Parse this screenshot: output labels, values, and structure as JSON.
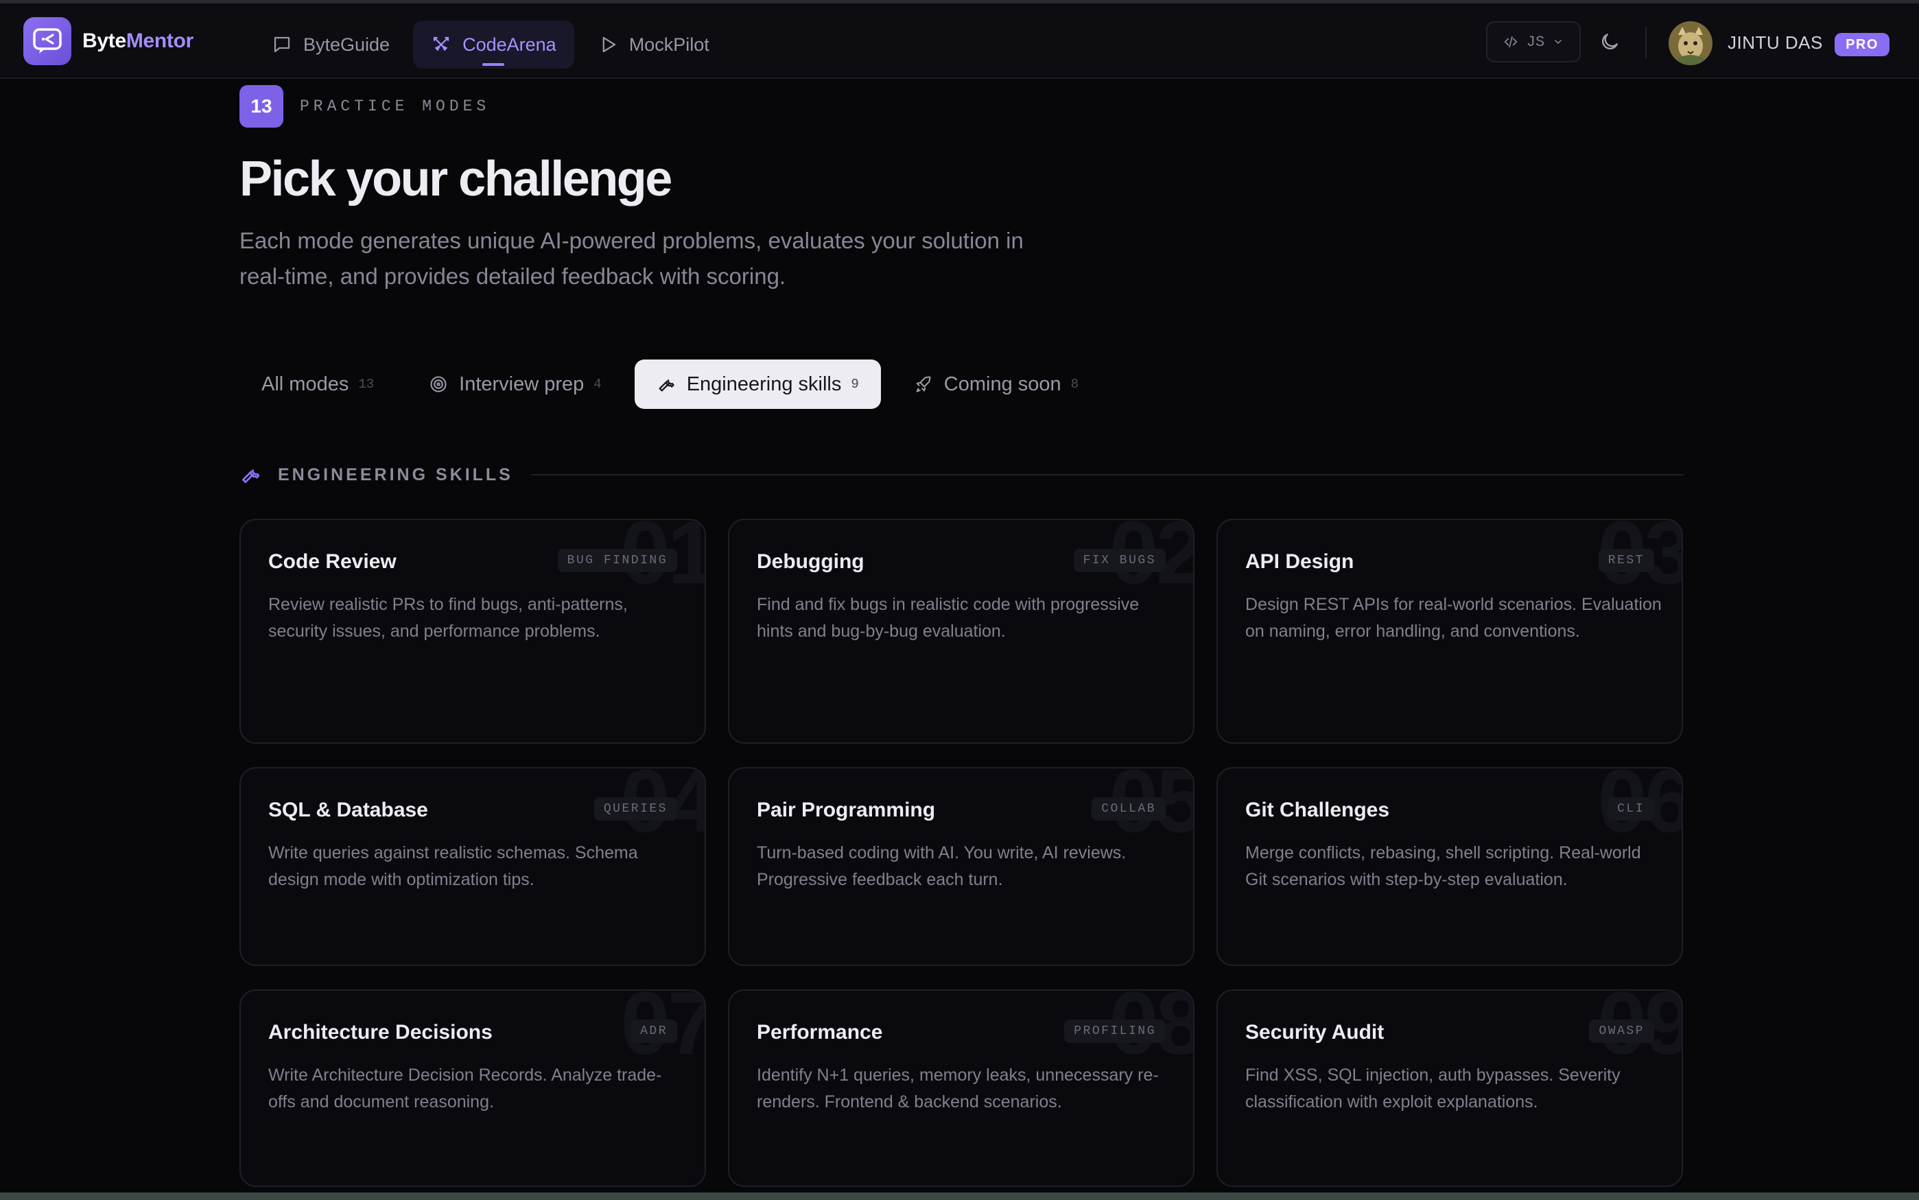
{
  "nav": {
    "brand_prefix": "Byte",
    "brand_accent": "Mentor",
    "tabs": [
      {
        "label": "ByteGuide",
        "icon": "chat-bubble-icon",
        "active": false
      },
      {
        "label": "CodeArena",
        "icon": "crossed-swords-icon",
        "active": true
      },
      {
        "label": "MockPilot",
        "icon": "play-icon",
        "active": false
      }
    ],
    "language": "JS",
    "user_name": "JINTU DAS",
    "plan_badge": "PRO"
  },
  "hero": {
    "count": "13",
    "eyebrow": "PRACTICE MODES",
    "title": "Pick your challenge",
    "subtitle": "Each mode generates unique AI-powered problems, evaluates your solution in real-time, and provides detailed feedback with scoring."
  },
  "filters": [
    {
      "label": "All modes",
      "count": "13",
      "icon": "",
      "active": false
    },
    {
      "label": "Interview prep",
      "count": "4",
      "icon": "target-icon",
      "active": false
    },
    {
      "label": "Engineering skills",
      "count": "9",
      "icon": "wrench-icon",
      "active": true
    },
    {
      "label": "Coming soon",
      "count": "8",
      "icon": "rocket-icon",
      "active": false
    }
  ],
  "section": {
    "label": "ENGINEERING SKILLS",
    "icon": "wrench-icon"
  },
  "cards": [
    {
      "num": "01",
      "title": "Code Review",
      "tag": "BUG FINDING",
      "desc": "Review realistic PRs to find bugs, anti-patterns, security issues, and performance problems."
    },
    {
      "num": "02",
      "title": "Debugging",
      "tag": "FIX BUGS",
      "desc": "Find and fix bugs in realistic code with progressive hints and bug-by-bug evaluation."
    },
    {
      "num": "03",
      "title": "API Design",
      "tag": "REST",
      "desc": "Design REST APIs for real-world scenarios. Evaluation on naming, error handling, and conventions."
    },
    {
      "num": "04",
      "title": "SQL & Database",
      "tag": "QUERIES",
      "desc": "Write queries against realistic schemas. Schema design mode with optimization tips."
    },
    {
      "num": "05",
      "title": "Pair Programming",
      "tag": "COLLAB",
      "desc": "Turn-based coding with AI. You write, AI reviews. Progressive feedback each turn."
    },
    {
      "num": "06",
      "title": "Git Challenges",
      "tag": "CLI",
      "desc": "Merge conflicts, rebasing, shell scripting. Real-world Git scenarios with step-by-step evaluation."
    },
    {
      "num": "07",
      "title": "Architecture Decisions",
      "tag": "ADR",
      "desc": "Write Architecture Decision Records. Analyze trade-offs and document reasoning."
    },
    {
      "num": "08",
      "title": "Performance",
      "tag": "PROFILING",
      "desc": "Identify N+1 queries, memory leaks, unnecessary re-renders. Frontend & backend scenarios."
    },
    {
      "num": "09",
      "title": "Security Audit",
      "tag": "OWASP",
      "desc": "Find XSS, SQL injection, auth bypasses. Severity classification with exploit explanations."
    }
  ]
}
